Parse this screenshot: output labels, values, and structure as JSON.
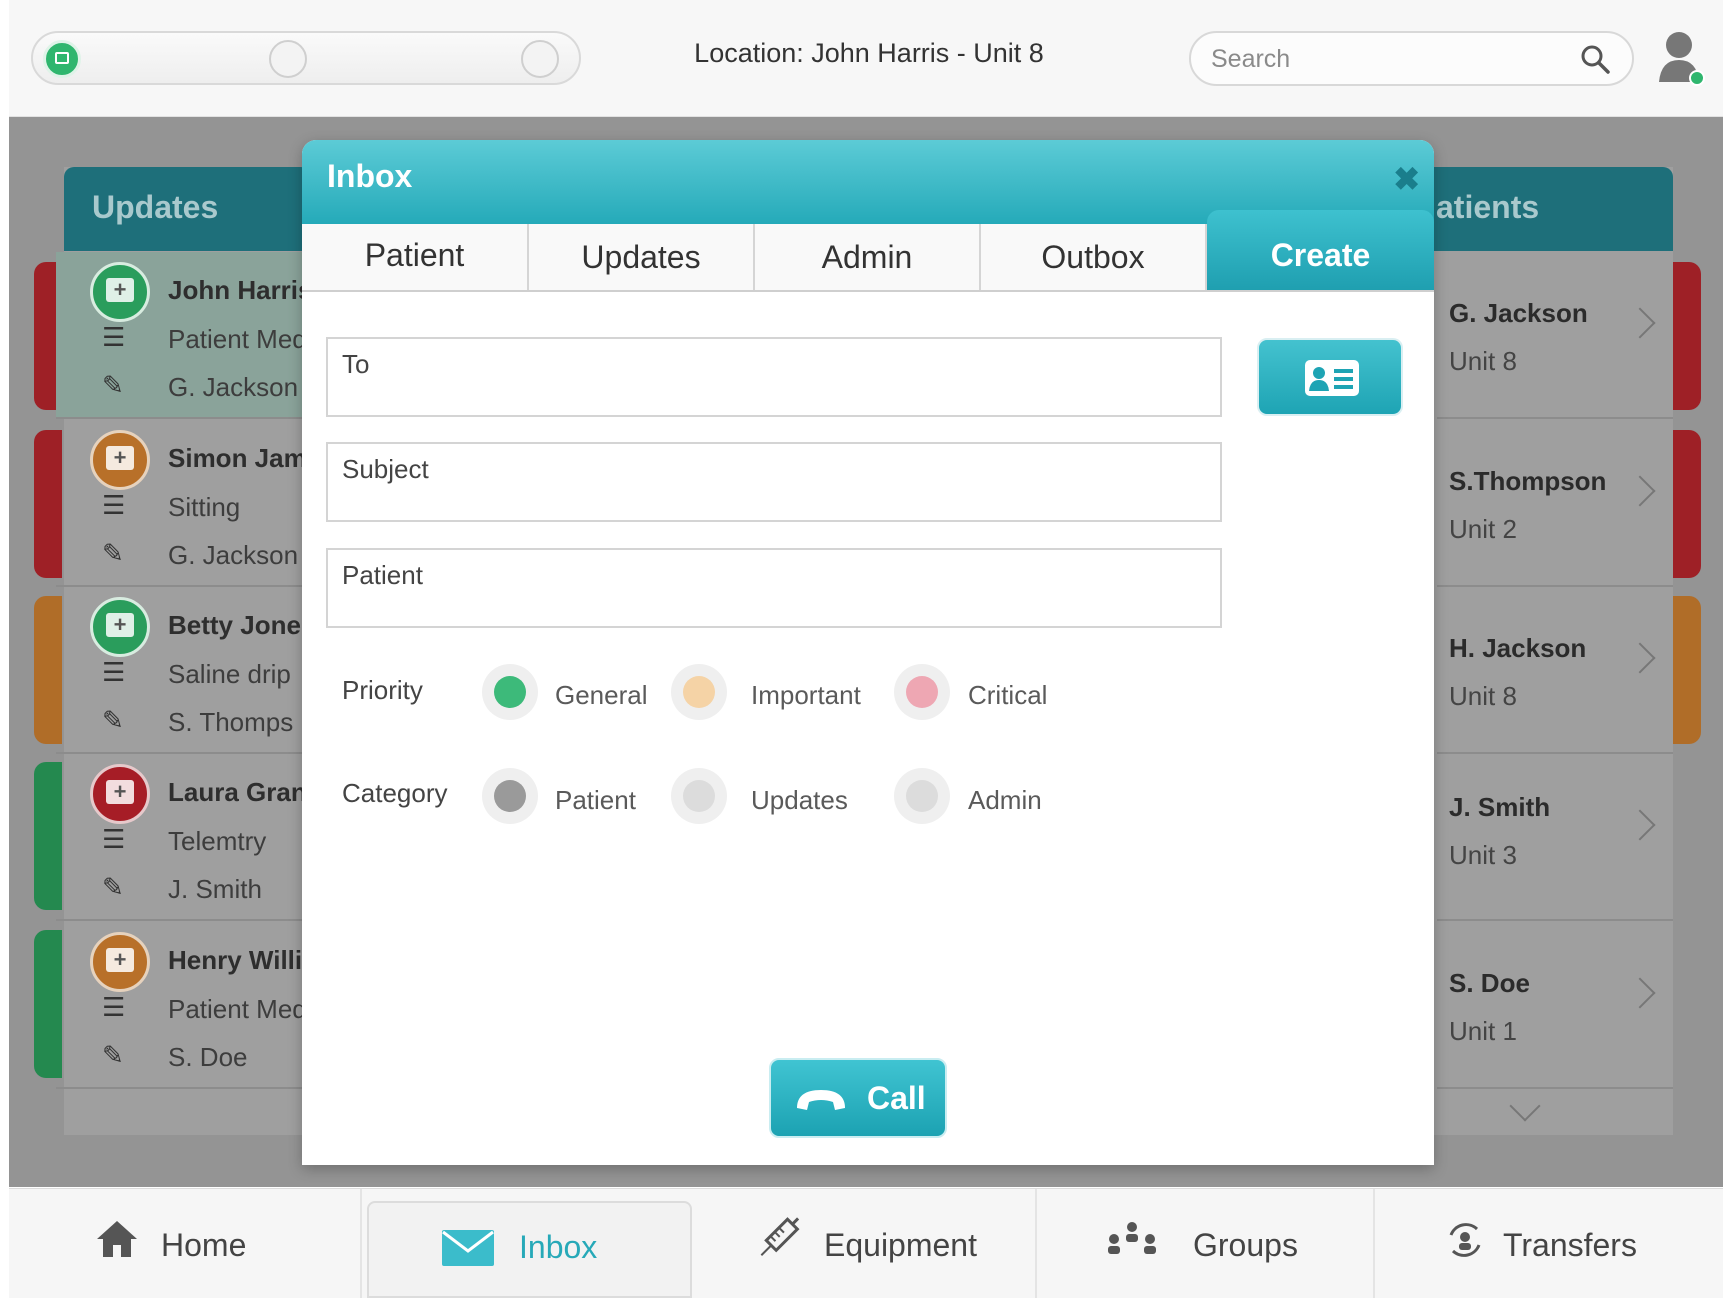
{
  "header": {
    "location": "Location: John Harris - Unit 8",
    "search_placeholder": "Search"
  },
  "left_panel": {
    "title": "Updates",
    "rows": [
      {
        "name": "John Harris",
        "detail": "Patient Med",
        "staff": "G. Jackson",
        "color": "#2fb66e",
        "strip": "#b0232b"
      },
      {
        "name": "Simon Jam",
        "detail": "Sitting",
        "staff": "G. Jackson",
        "color": "#c8782a",
        "strip": "#b0232b"
      },
      {
        "name": "Betty Jone",
        "detail": "Saline drip",
        "staff": "S. Thomps",
        "color": "#2fb66e",
        "strip": "#c8782a"
      },
      {
        "name": "Laura Gran",
        "detail": "Telemtry",
        "staff": "J. Smith",
        "color": "#b0232b",
        "strip": "#2a9d5c"
      },
      {
        "name": "Henry Willi",
        "detail": "Patient Med",
        "staff": "S. Doe",
        "color": "#c8782a",
        "strip": "#2a9d5c"
      }
    ]
  },
  "right_panel": {
    "title": "Patients",
    "title_visible": "atients",
    "rows": [
      {
        "name": "G. Jackson",
        "unit": "Unit 8",
        "strip": "#b0232b"
      },
      {
        "name": "S.Thompson",
        "unit": "Unit 2",
        "strip": "#b0232b"
      },
      {
        "name": "H. Jackson",
        "unit": "Unit 8",
        "strip": "#c8782a"
      },
      {
        "name": "J. Smith",
        "unit": "Unit 3",
        "strip": ""
      },
      {
        "name": "S. Doe",
        "unit": "Unit 1",
        "strip": ""
      }
    ]
  },
  "modal": {
    "title": "Inbox",
    "close": "✖",
    "tabs": [
      "Patient",
      "Updates",
      "Admin",
      "Outbox",
      "Create"
    ],
    "active_tab": "Create",
    "fields": {
      "to_label": "To",
      "subject_label": "Subject",
      "patient_label": "Patient"
    },
    "priority": {
      "label": "Priority",
      "options": [
        {
          "label": "General",
          "color": "#3dba7a",
          "selected": true
        },
        {
          "label": "Important",
          "color": "#f5d3a6",
          "selected": false
        },
        {
          "label": "Critical",
          "color": "#eea7b3",
          "selected": false
        }
      ]
    },
    "category": {
      "label": "Category",
      "options": [
        {
          "label": "Patient",
          "color": "#9a9a9a",
          "selected": true
        },
        {
          "label": "Updates",
          "color": "#dcdcdc",
          "selected": false
        },
        {
          "label": "Admin",
          "color": "#dcdcdc",
          "selected": false
        }
      ]
    },
    "call_label": "Call"
  },
  "bottom_nav": [
    {
      "label": "Home",
      "icon": "home-icon"
    },
    {
      "label": "Inbox",
      "icon": "envelope-icon",
      "active": true
    },
    {
      "label": "Equipment",
      "icon": "syringe-icon"
    },
    {
      "label": "Groups",
      "icon": "groups-icon"
    },
    {
      "label": "Transfers",
      "icon": "transfers-icon"
    }
  ],
  "colors": {
    "accent": "#27a9b8",
    "panel_header": "#1e6f7a"
  }
}
